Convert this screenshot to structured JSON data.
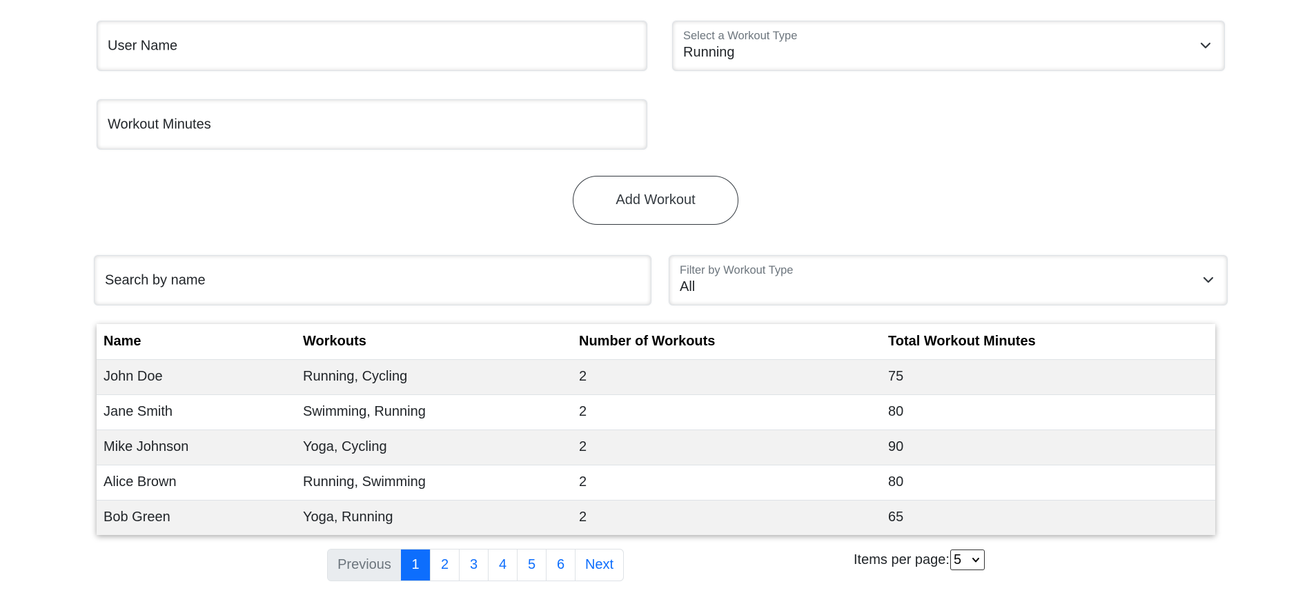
{
  "form": {
    "user_name_placeholder": "User Name",
    "workout_type_label": "Select a Workout Type",
    "workout_type_value": "Running",
    "workout_minutes_placeholder": "Workout Minutes",
    "add_button": "Add Workout"
  },
  "filters": {
    "search_placeholder": "Search by name",
    "filter_label": "Filter by Workout Type",
    "filter_value": "All"
  },
  "table": {
    "headers": [
      "Name",
      "Workouts",
      "Number of Workouts",
      "Total Workout Minutes"
    ],
    "rows": [
      [
        "John Doe",
        "Running, Cycling",
        "2",
        "75"
      ],
      [
        "Jane Smith",
        "Swimming, Running",
        "2",
        "80"
      ],
      [
        "Mike Johnson",
        "Yoga, Cycling",
        "2",
        "90"
      ],
      [
        "Alice Brown",
        "Running, Swimming",
        "2",
        "80"
      ],
      [
        "Bob Green",
        "Yoga, Running",
        "2",
        "65"
      ]
    ]
  },
  "pagination": {
    "previous": "Previous",
    "pages": [
      "1",
      "2",
      "3",
      "4",
      "5",
      "6"
    ],
    "active_page": "1",
    "next": "Next"
  },
  "items_per_page": {
    "label": "Items per page:",
    "value": "5"
  },
  "colors": {
    "accent": "#0d6efd",
    "stripe": "#f2f2f2"
  },
  "icons": {
    "select_arrow": "chevron-down-icon"
  }
}
